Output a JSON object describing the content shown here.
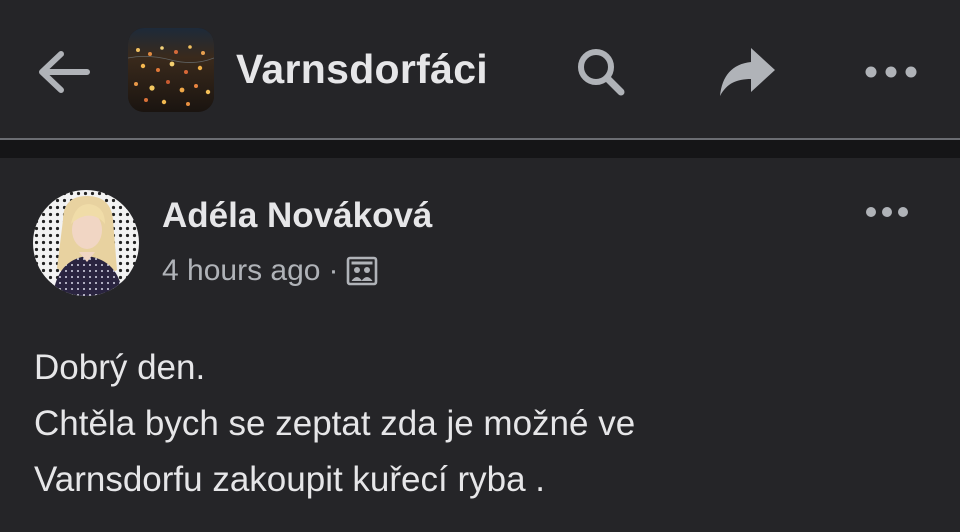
{
  "header": {
    "group_name": "Varnsdorfáci",
    "back_icon": "arrow-left-icon",
    "search_icon": "search-icon",
    "share_icon": "share-icon",
    "more_icon": "more-horizontal-icon"
  },
  "post": {
    "author": "Adéla Nováková",
    "timestamp": "4 hours ago",
    "separator": "·",
    "privacy_icon": "group-audience-icon",
    "more_icon": "more-horizontal-icon",
    "body_lines": [
      "Dobrý den.",
      "Chtěla bych se zeptat zda je možné ve",
      "Varnsdorfu zakoupit kuřecí ryba ."
    ]
  },
  "colors": {
    "background": "#252528",
    "separator": "#151517",
    "text_primary": "#e6e6e8",
    "text_secondary": "#b0b3b8",
    "icon": "#b0b3b8"
  }
}
